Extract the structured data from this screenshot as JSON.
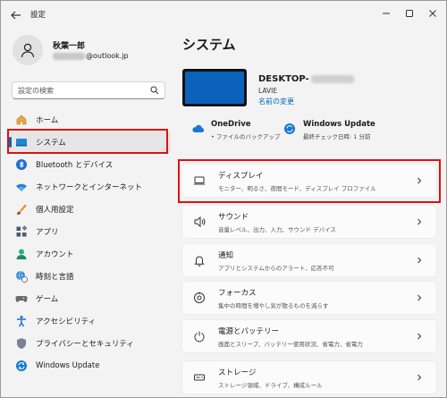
{
  "window": {
    "title": "設定"
  },
  "profile": {
    "name": "秋葉一郎",
    "email_domain": "@outlook.jp"
  },
  "search": {
    "placeholder": "設定の検索"
  },
  "nav": {
    "items": [
      {
        "label": "ホーム",
        "icon": "home-icon"
      },
      {
        "label": "システム",
        "icon": "system-display-icon",
        "selected": true
      },
      {
        "label": "Bluetooth とデバイス",
        "icon": "bluetooth-icon"
      },
      {
        "label": "ネットワークとインターネット",
        "icon": "wifi-icon"
      },
      {
        "label": "個人用設定",
        "icon": "brush-icon"
      },
      {
        "label": "アプリ",
        "icon": "apps-icon"
      },
      {
        "label": "アカウント",
        "icon": "account-icon"
      },
      {
        "label": "時刻と言語",
        "icon": "globe-clock-icon"
      },
      {
        "label": "ゲーム",
        "icon": "gamepad-icon"
      },
      {
        "label": "アクセシビリティ",
        "icon": "accessibility-icon"
      },
      {
        "label": "プライバシーとセキュリティ",
        "icon": "shield-icon"
      },
      {
        "label": "Windows Update",
        "icon": "update-icon"
      }
    ]
  },
  "main": {
    "title": "システム",
    "device": {
      "name": "DESKTOP-",
      "model": "LAVIE",
      "rename": "名前の変更"
    },
    "status": {
      "onedrive": {
        "title": "OneDrive",
        "subtitle": "• ファイルのバックアップ"
      },
      "update": {
        "title": "Windows Update",
        "subtitle": "最終チェック日時: 1 分前"
      }
    },
    "cards": [
      {
        "title": "ディスプレイ",
        "subtitle": "モニター、明るさ、夜間モード、ディスプレイ プロファイル",
        "icon": "display-icon"
      },
      {
        "title": "サウンド",
        "subtitle": "音量レベル、出力、入力、サウンド デバイス",
        "icon": "speaker-icon"
      },
      {
        "title": "通知",
        "subtitle": "アプリとシステムからのアラート、応答不可",
        "icon": "bell-icon"
      },
      {
        "title": "フォーカス",
        "subtitle": "集中の時間を増やし気が散るものを減らす",
        "icon": "focus-icon"
      },
      {
        "title": "電源とバッテリー",
        "subtitle": "画面とスリープ、バッテリー使用状況、省電力、省電力",
        "icon": "power-icon"
      },
      {
        "title": "ストレージ",
        "subtitle": "ストレージ領域、ドライブ、構成ルール",
        "icon": "storage-icon"
      }
    ]
  },
  "colors": {
    "accent": "#0067c0",
    "highlight": "#e01010",
    "background": "#f3f3f3"
  }
}
